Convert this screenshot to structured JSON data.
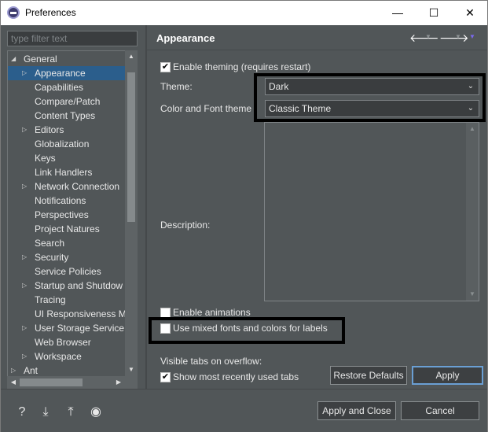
{
  "window": {
    "title": "Preferences",
    "minimize": "—",
    "maximize": "☐",
    "close": "✕"
  },
  "filter": {
    "placeholder": "type filter text"
  },
  "tree": {
    "items": [
      {
        "label": "General",
        "level": 0,
        "arrow": "◢",
        "selected": false
      },
      {
        "label": "Appearance",
        "level": 1,
        "arrow": "▷",
        "selected": true
      },
      {
        "label": "Capabilities",
        "level": 1,
        "arrow": "",
        "selected": false
      },
      {
        "label": "Compare/Patch",
        "level": 1,
        "arrow": "",
        "selected": false
      },
      {
        "label": "Content Types",
        "level": 1,
        "arrow": "",
        "selected": false
      },
      {
        "label": "Editors",
        "level": 1,
        "arrow": "▷",
        "selected": false
      },
      {
        "label": "Globalization",
        "level": 1,
        "arrow": "",
        "selected": false
      },
      {
        "label": "Keys",
        "level": 1,
        "arrow": "",
        "selected": false
      },
      {
        "label": "Link Handlers",
        "level": 1,
        "arrow": "",
        "selected": false
      },
      {
        "label": "Network Connection",
        "level": 1,
        "arrow": "▷",
        "selected": false
      },
      {
        "label": "Notifications",
        "level": 1,
        "arrow": "",
        "selected": false
      },
      {
        "label": "Perspectives",
        "level": 1,
        "arrow": "",
        "selected": false
      },
      {
        "label": "Project Natures",
        "level": 1,
        "arrow": "",
        "selected": false
      },
      {
        "label": "Search",
        "level": 1,
        "arrow": "",
        "selected": false
      },
      {
        "label": "Security",
        "level": 1,
        "arrow": "▷",
        "selected": false
      },
      {
        "label": "Service Policies",
        "level": 1,
        "arrow": "",
        "selected": false
      },
      {
        "label": "Startup and Shutdow",
        "level": 1,
        "arrow": "▷",
        "selected": false
      },
      {
        "label": "Tracing",
        "level": 1,
        "arrow": "",
        "selected": false
      },
      {
        "label": "UI Responsiveness M",
        "level": 1,
        "arrow": "",
        "selected": false
      },
      {
        "label": "User Storage Service",
        "level": 1,
        "arrow": "▷",
        "selected": false
      },
      {
        "label": "Web Browser",
        "level": 1,
        "arrow": "",
        "selected": false
      },
      {
        "label": "Workspace",
        "level": 1,
        "arrow": "▷",
        "selected": false
      },
      {
        "label": "Ant",
        "level": 0,
        "arrow": "▷",
        "selected": false
      }
    ]
  },
  "page": {
    "title": "Appearance",
    "back_icon": "🡐",
    "forward_icon": "🡒",
    "menu_icon": "▼"
  },
  "appearance": {
    "enable_theming": {
      "label": "Enable theming (requires restart)",
      "checked": true
    },
    "theme": {
      "label": "Theme:",
      "value": "Dark"
    },
    "color_font_theme": {
      "label": "Color and Font theme",
      "value": "Classic Theme"
    },
    "description_label": "Description:",
    "enable_animations": {
      "label": "Enable animations",
      "checked": false
    },
    "mixed_fonts": {
      "label": "Use mixed fonts and colors for labels",
      "checked": false
    },
    "visible_tabs_label": "Visible tabs on overflow:",
    "show_recent_tabs": {
      "label": "Show most recently used tabs",
      "checked": true
    }
  },
  "buttons": {
    "restore_defaults": "Restore Defaults",
    "apply": "Apply",
    "apply_and_close": "Apply and Close",
    "cancel": "Cancel"
  },
  "bottom_icons": [
    "help-icon",
    "import-icon",
    "export-icon",
    "record-icon"
  ],
  "colors": {
    "background": "#515658",
    "selection": "#2b5e8c",
    "highlight_frame": "#000000",
    "primary_button_border": "#6a9fd4"
  }
}
